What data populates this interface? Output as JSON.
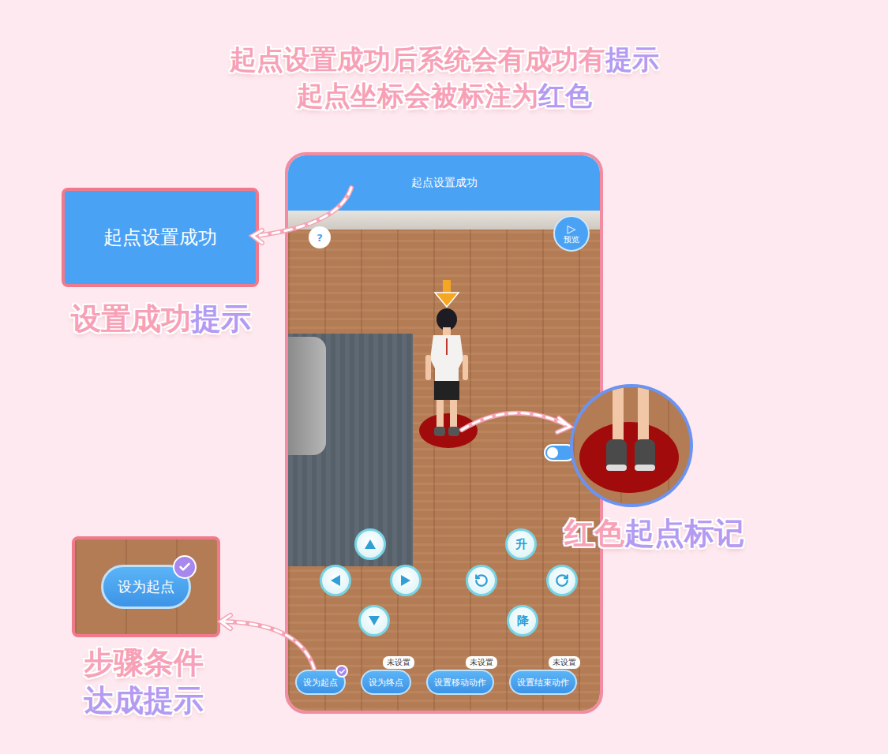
{
  "title": [
    [
      {
        "text": "起点设置成功后系统会有成功有",
        "highlight": false
      },
      {
        "text": "提示",
        "highlight": true
      }
    ],
    [
      {
        "text": "起点坐标会被标注为",
        "highlight": false
      },
      {
        "text": "红色",
        "highlight": true
      }
    ]
  ],
  "phone": {
    "header": "起点设置成功",
    "help": "?",
    "preview": {
      "icon": "▷",
      "label": "预览"
    },
    "vertical_controls": [
      {
        "label": "升"
      },
      {
        "label": "降"
      }
    ],
    "steps": [
      {
        "label": "设为起点",
        "done": true,
        "badge": null
      },
      {
        "label": "设为终点",
        "done": false,
        "badge": "未设置"
      },
      {
        "label": "设置移动动作",
        "done": false,
        "badge": "未设置"
      },
      {
        "label": "设置结束动作",
        "done": false,
        "badge": "未设置"
      }
    ]
  },
  "callouts": {
    "toast": {
      "text": "起点设置成功",
      "caption": [
        {
          "text": "设置成功",
          "highlight": false
        },
        {
          "text": "提示",
          "highlight": true
        }
      ]
    },
    "marker": {
      "caption": [
        {
          "text": "红色",
          "highlight": false
        },
        {
          "text": "起点标记",
          "highlight": true
        }
      ]
    },
    "step": {
      "button": "设为起点",
      "done": true,
      "caption_lines": [
        [
          {
            "text": "步骤条件",
            "highlight": false
          }
        ],
        [
          {
            "text": "达成提示",
            "highlight": true
          }
        ]
      ]
    }
  }
}
